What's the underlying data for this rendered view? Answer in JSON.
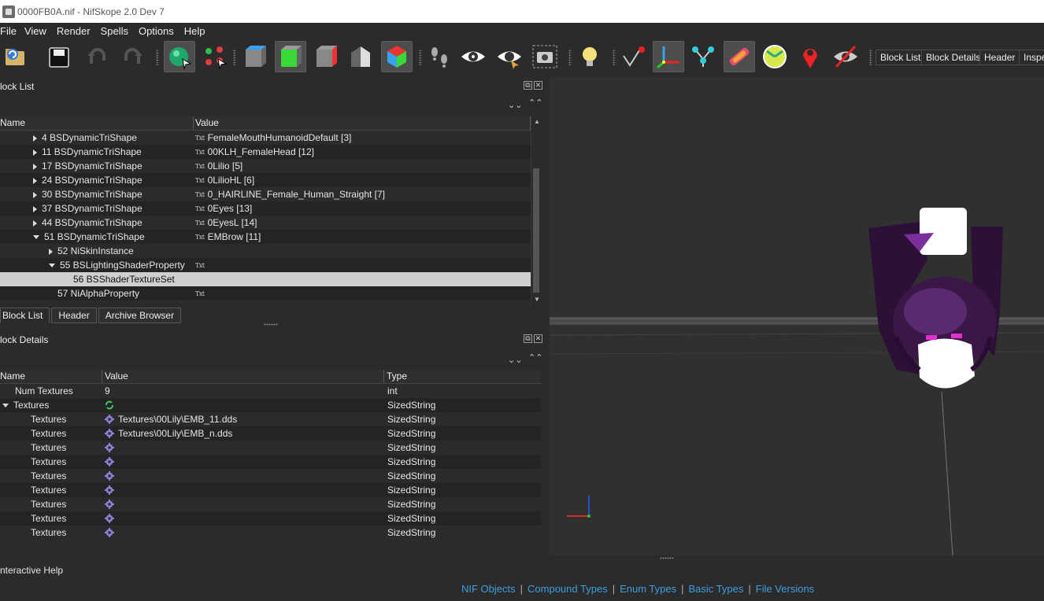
{
  "window": {
    "title": "0000FB0A.nif - NifSkope 2.0 Dev 7"
  },
  "menu": [
    "File",
    "View",
    "Render",
    "Spells",
    "Options",
    "Help"
  ],
  "toolbar": {
    "buttons": [
      "open-icon",
      "save-icon",
      "undo-icon",
      "redo-icon",
      "select-object-icon",
      "select-vertex-icon",
      "view-top-icon",
      "view-front-icon",
      "view-side-icon",
      "view-user-icon",
      "view-flip-icon",
      "walk-icon",
      "show-hidden-icon",
      "show-selected-icon",
      "screenshot-icon",
      "lighting-icon",
      "show-vertices-icon",
      "show-axes-icon",
      "show-nodes-icon",
      "show-collision-icon",
      "show-constraints-icon",
      "show-markers-icon",
      "hide-marker-icon"
    ],
    "dock_buttons": [
      "Block List",
      "Block Details",
      "Header",
      "Inspe"
    ]
  },
  "block_list": {
    "title": "lock List",
    "columns": [
      "Name",
      "Value"
    ],
    "rows": [
      {
        "name": "4 BSDynamicTriShape",
        "value": "FemaleMouthHumanoidDefault [3]",
        "expand": "right",
        "indent": 0,
        "txt": true
      },
      {
        "name": "11 BSDynamicTriShape",
        "value": "00KLH_FemaleHead [12]",
        "expand": "right",
        "indent": 0,
        "txt": true
      },
      {
        "name": "17 BSDynamicTriShape",
        "value": "0Lilio [5]",
        "expand": "right",
        "indent": 0,
        "txt": true
      },
      {
        "name": "24 BSDynamicTriShape",
        "value": "0LilioHL [6]",
        "expand": "right",
        "indent": 0,
        "txt": true
      },
      {
        "name": "30 BSDynamicTriShape",
        "value": "0_HAIRLINE_Female_Human_Straight [7]",
        "expand": "right",
        "indent": 0,
        "txt": true
      },
      {
        "name": "37 BSDynamicTriShape",
        "value": "0Eyes [13]",
        "expand": "right",
        "indent": 0,
        "txt": true
      },
      {
        "name": "44 BSDynamicTriShape",
        "value": "0EyesL [14]",
        "expand": "right",
        "indent": 0,
        "txt": true
      },
      {
        "name": "51 BSDynamicTriShape",
        "value": "EMBrow [11]",
        "expand": "down",
        "indent": 0,
        "txt": true
      },
      {
        "name": "52 NiSkinInstance",
        "value": "",
        "expand": "right",
        "indent": 1,
        "txt": false
      },
      {
        "name": "55 BSLightingShaderProperty",
        "value": "",
        "expand": "down",
        "indent": 1,
        "txt": true
      },
      {
        "name": "56 BSShaderTextureSet",
        "value": "",
        "expand": "none",
        "indent": 2,
        "txt": false,
        "selected": true
      },
      {
        "name": "57 NiAlphaProperty",
        "value": "",
        "expand": "none",
        "indent": 1,
        "txt": true
      }
    ]
  },
  "tabs": [
    "Block List",
    "Header",
    "Archive Browser"
  ],
  "block_details": {
    "title": "lock Details",
    "columns": [
      "Name",
      "Value",
      "Type"
    ],
    "rows": [
      {
        "name": "Num Textures",
        "value": "9",
        "type": "int",
        "icon": "",
        "expand": "none",
        "indent": 0
      },
      {
        "name": "Textures",
        "value": "",
        "type": "SizedString",
        "icon": "refresh-icon",
        "expand": "down",
        "indent": 0
      },
      {
        "name": "Textures",
        "value": "Textures\\00Lily\\EMB_11.dds",
        "type": "SizedString",
        "icon": "gear-icon",
        "expand": "none",
        "indent": 1
      },
      {
        "name": "Textures",
        "value": "Textures\\00Lily\\EMB_n.dds",
        "type": "SizedString",
        "icon": "gear-icon",
        "expand": "none",
        "indent": 1
      },
      {
        "name": "Textures",
        "value": "",
        "type": "SizedString",
        "icon": "gear-icon",
        "expand": "none",
        "indent": 1
      },
      {
        "name": "Textures",
        "value": "",
        "type": "SizedString",
        "icon": "gear-icon",
        "expand": "none",
        "indent": 1
      },
      {
        "name": "Textures",
        "value": "",
        "type": "SizedString",
        "icon": "gear-icon",
        "expand": "none",
        "indent": 1
      },
      {
        "name": "Textures",
        "value": "",
        "type": "SizedString",
        "icon": "gear-icon",
        "expand": "none",
        "indent": 1
      },
      {
        "name": "Textures",
        "value": "",
        "type": "SizedString",
        "icon": "gear-icon",
        "expand": "none",
        "indent": 1
      },
      {
        "name": "Textures",
        "value": "",
        "type": "SizedString",
        "icon": "gear-icon",
        "expand": "none",
        "indent": 1
      },
      {
        "name": "Textures",
        "value": "",
        "type": "SizedString",
        "icon": "gear-icon",
        "expand": "none",
        "indent": 1
      }
    ]
  },
  "help": {
    "title": "nteractive Help",
    "links": [
      "NIF Objects",
      "Compound Types",
      "Enum Types",
      "Basic Types",
      "File Versions"
    ]
  },
  "colors": {
    "link": "#3d9ee0",
    "selection": "#cfcfcf",
    "hair": "#3a1746"
  }
}
